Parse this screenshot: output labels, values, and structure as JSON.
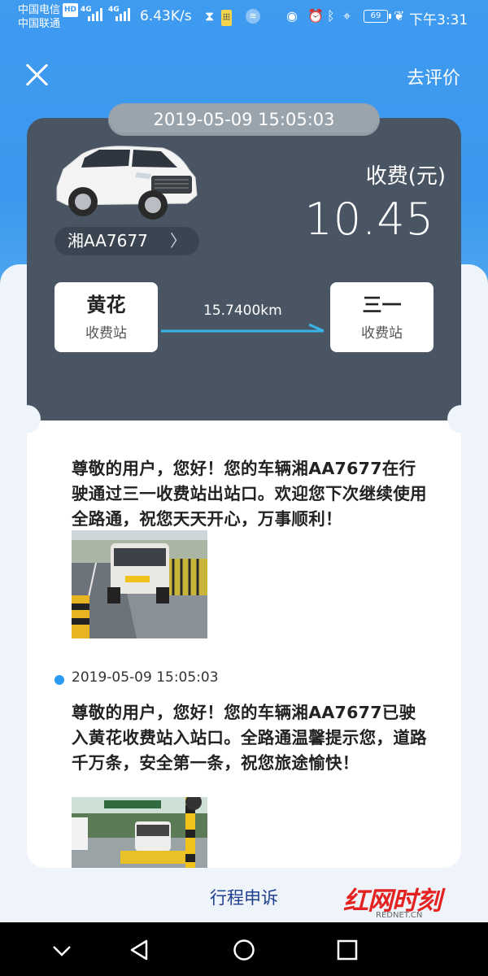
{
  "status_bar": {
    "carrier_1": "中国电信",
    "hd_badge": "HD",
    "carrier_2": "中国联通",
    "net_1": "4G",
    "net_2": "4G",
    "speed": "6.43K/s",
    "battery": "69",
    "time": "下午3:31"
  },
  "header": {
    "review_label": "去评价"
  },
  "trip": {
    "datetime": "2019-05-09 15:05:03",
    "plate": "湘AA7677",
    "fee_label": "收费(元)",
    "fee_amount": "10.45",
    "distance": "15.7400km",
    "entry_station": {
      "name": "黄花",
      "sub": "收费站"
    },
    "exit_station": {
      "name": "三一",
      "sub": "收费站"
    }
  },
  "messages": [
    {
      "text": "尊敬的用户，您好！您的车辆湘AA7677在行驶通过三一收费站出站口。欢迎您下次继续使用全路通，祝您天天开心，万事顺利！"
    },
    {
      "time": "2019-05-09 15:05:03",
      "text": "尊敬的用户，您好！您的车辆湘AA7677已驶入黄花收费站入站口。全路通温馨提示您，道路千万条，安全第一条，祝您旅途愉快！"
    }
  ],
  "footer": {
    "appeal_label": "行程申诉"
  },
  "watermark": {
    "logo_text": "红网时刻",
    "site": "REDNET.CN"
  },
  "colors": {
    "primary_blue": "#3a98ee",
    "card_dark": "#4a5564",
    "route_line": "#3ab4e8",
    "dot_blue": "#2a9bf0",
    "watermark_red": "#e42221"
  }
}
